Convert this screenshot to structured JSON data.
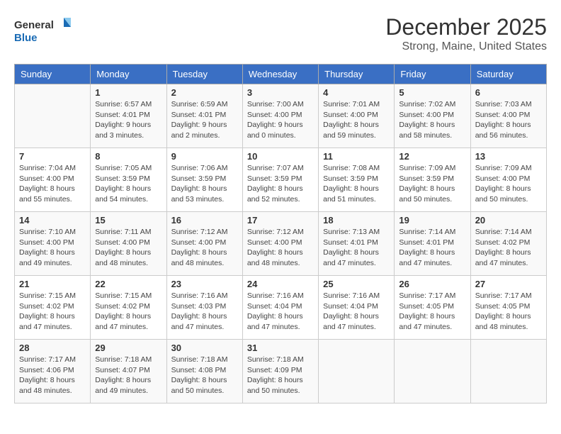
{
  "header": {
    "logo_general": "General",
    "logo_blue": "Blue",
    "month_title": "December 2025",
    "location": "Strong, Maine, United States"
  },
  "days_of_week": [
    "Sunday",
    "Monday",
    "Tuesday",
    "Wednesday",
    "Thursday",
    "Friday",
    "Saturday"
  ],
  "weeks": [
    [
      {
        "num": "",
        "sunrise": "",
        "sunset": "",
        "daylight": ""
      },
      {
        "num": "1",
        "sunrise": "Sunrise: 6:57 AM",
        "sunset": "Sunset: 4:01 PM",
        "daylight": "Daylight: 9 hours and 3 minutes."
      },
      {
        "num": "2",
        "sunrise": "Sunrise: 6:59 AM",
        "sunset": "Sunset: 4:01 PM",
        "daylight": "Daylight: 9 hours and 2 minutes."
      },
      {
        "num": "3",
        "sunrise": "Sunrise: 7:00 AM",
        "sunset": "Sunset: 4:00 PM",
        "daylight": "Daylight: 9 hours and 0 minutes."
      },
      {
        "num": "4",
        "sunrise": "Sunrise: 7:01 AM",
        "sunset": "Sunset: 4:00 PM",
        "daylight": "Daylight: 8 hours and 59 minutes."
      },
      {
        "num": "5",
        "sunrise": "Sunrise: 7:02 AM",
        "sunset": "Sunset: 4:00 PM",
        "daylight": "Daylight: 8 hours and 58 minutes."
      },
      {
        "num": "6",
        "sunrise": "Sunrise: 7:03 AM",
        "sunset": "Sunset: 4:00 PM",
        "daylight": "Daylight: 8 hours and 56 minutes."
      }
    ],
    [
      {
        "num": "7",
        "sunrise": "Sunrise: 7:04 AM",
        "sunset": "Sunset: 4:00 PM",
        "daylight": "Daylight: 8 hours and 55 minutes."
      },
      {
        "num": "8",
        "sunrise": "Sunrise: 7:05 AM",
        "sunset": "Sunset: 3:59 PM",
        "daylight": "Daylight: 8 hours and 54 minutes."
      },
      {
        "num": "9",
        "sunrise": "Sunrise: 7:06 AM",
        "sunset": "Sunset: 3:59 PM",
        "daylight": "Daylight: 8 hours and 53 minutes."
      },
      {
        "num": "10",
        "sunrise": "Sunrise: 7:07 AM",
        "sunset": "Sunset: 3:59 PM",
        "daylight": "Daylight: 8 hours and 52 minutes."
      },
      {
        "num": "11",
        "sunrise": "Sunrise: 7:08 AM",
        "sunset": "Sunset: 3:59 PM",
        "daylight": "Daylight: 8 hours and 51 minutes."
      },
      {
        "num": "12",
        "sunrise": "Sunrise: 7:09 AM",
        "sunset": "Sunset: 3:59 PM",
        "daylight": "Daylight: 8 hours and 50 minutes."
      },
      {
        "num": "13",
        "sunrise": "Sunrise: 7:09 AM",
        "sunset": "Sunset: 4:00 PM",
        "daylight": "Daylight: 8 hours and 50 minutes."
      }
    ],
    [
      {
        "num": "14",
        "sunrise": "Sunrise: 7:10 AM",
        "sunset": "Sunset: 4:00 PM",
        "daylight": "Daylight: 8 hours and 49 minutes."
      },
      {
        "num": "15",
        "sunrise": "Sunrise: 7:11 AM",
        "sunset": "Sunset: 4:00 PM",
        "daylight": "Daylight: 8 hours and 48 minutes."
      },
      {
        "num": "16",
        "sunrise": "Sunrise: 7:12 AM",
        "sunset": "Sunset: 4:00 PM",
        "daylight": "Daylight: 8 hours and 48 minutes."
      },
      {
        "num": "17",
        "sunrise": "Sunrise: 7:12 AM",
        "sunset": "Sunset: 4:00 PM",
        "daylight": "Daylight: 8 hours and 48 minutes."
      },
      {
        "num": "18",
        "sunrise": "Sunrise: 7:13 AM",
        "sunset": "Sunset: 4:01 PM",
        "daylight": "Daylight: 8 hours and 47 minutes."
      },
      {
        "num": "19",
        "sunrise": "Sunrise: 7:14 AM",
        "sunset": "Sunset: 4:01 PM",
        "daylight": "Daylight: 8 hours and 47 minutes."
      },
      {
        "num": "20",
        "sunrise": "Sunrise: 7:14 AM",
        "sunset": "Sunset: 4:02 PM",
        "daylight": "Daylight: 8 hours and 47 minutes."
      }
    ],
    [
      {
        "num": "21",
        "sunrise": "Sunrise: 7:15 AM",
        "sunset": "Sunset: 4:02 PM",
        "daylight": "Daylight: 8 hours and 47 minutes."
      },
      {
        "num": "22",
        "sunrise": "Sunrise: 7:15 AM",
        "sunset": "Sunset: 4:02 PM",
        "daylight": "Daylight: 8 hours and 47 minutes."
      },
      {
        "num": "23",
        "sunrise": "Sunrise: 7:16 AM",
        "sunset": "Sunset: 4:03 PM",
        "daylight": "Daylight: 8 hours and 47 minutes."
      },
      {
        "num": "24",
        "sunrise": "Sunrise: 7:16 AM",
        "sunset": "Sunset: 4:04 PM",
        "daylight": "Daylight: 8 hours and 47 minutes."
      },
      {
        "num": "25",
        "sunrise": "Sunrise: 7:16 AM",
        "sunset": "Sunset: 4:04 PM",
        "daylight": "Daylight: 8 hours and 47 minutes."
      },
      {
        "num": "26",
        "sunrise": "Sunrise: 7:17 AM",
        "sunset": "Sunset: 4:05 PM",
        "daylight": "Daylight: 8 hours and 47 minutes."
      },
      {
        "num": "27",
        "sunrise": "Sunrise: 7:17 AM",
        "sunset": "Sunset: 4:05 PM",
        "daylight": "Daylight: 8 hours and 48 minutes."
      }
    ],
    [
      {
        "num": "28",
        "sunrise": "Sunrise: 7:17 AM",
        "sunset": "Sunset: 4:06 PM",
        "daylight": "Daylight: 8 hours and 48 minutes."
      },
      {
        "num": "29",
        "sunrise": "Sunrise: 7:18 AM",
        "sunset": "Sunset: 4:07 PM",
        "daylight": "Daylight: 8 hours and 49 minutes."
      },
      {
        "num": "30",
        "sunrise": "Sunrise: 7:18 AM",
        "sunset": "Sunset: 4:08 PM",
        "daylight": "Daylight: 8 hours and 50 minutes."
      },
      {
        "num": "31",
        "sunrise": "Sunrise: 7:18 AM",
        "sunset": "Sunset: 4:09 PM",
        "daylight": "Daylight: 8 hours and 50 minutes."
      },
      {
        "num": "",
        "sunrise": "",
        "sunset": "",
        "daylight": ""
      },
      {
        "num": "",
        "sunrise": "",
        "sunset": "",
        "daylight": ""
      },
      {
        "num": "",
        "sunrise": "",
        "sunset": "",
        "daylight": ""
      }
    ]
  ]
}
